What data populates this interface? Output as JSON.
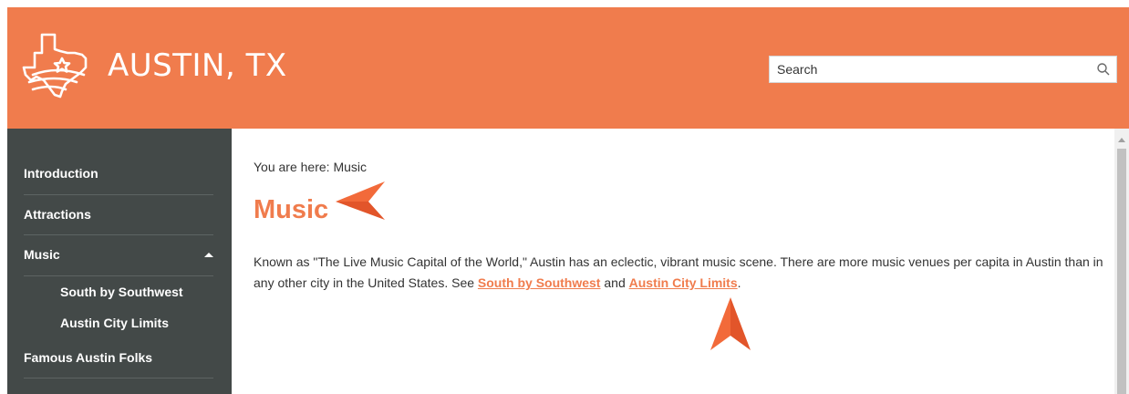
{
  "header": {
    "brand_name": "AUSTIN, TX",
    "search_placeholder": "Search",
    "bg_color": "#f07c4d"
  },
  "sidebar": {
    "items": [
      {
        "label": "Introduction"
      },
      {
        "label": "Attractions"
      },
      {
        "label": "Music",
        "expanded": true,
        "children": [
          {
            "label": "South by Southwest"
          },
          {
            "label": "Austin City Limits"
          }
        ]
      },
      {
        "label": "Famous Austin Folks"
      }
    ],
    "bg_color": "#434948"
  },
  "content": {
    "breadcrumb": "You are here: Music",
    "title": "Music",
    "paragraph_text": "Known as \"The Live Music Capital of the World,\" Austin has an eclectic, vibrant music scene. There are more music venues per capita in Austin than in any other city in the United States. See ",
    "link1": "South by Southwest",
    "connector": " and ",
    "link2": "Austin City Limits",
    "ending": ".",
    "accent_color": "#f07c4d"
  },
  "icons": {
    "logo": "texas-star-logo-icon",
    "search": "search-icon",
    "caret": "caret-up-icon",
    "callout": "arrow-pointer-icon"
  }
}
